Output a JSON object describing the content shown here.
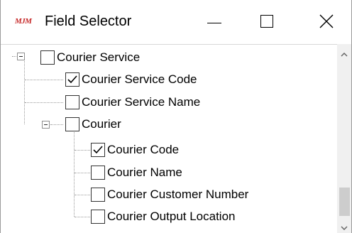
{
  "window": {
    "logo_text": "MJM",
    "title": "Field Selector"
  },
  "tree": {
    "nodes": [
      {
        "label": "Courier Service",
        "checked": false,
        "expandable": true,
        "expanded": true
      },
      {
        "label": "Courier Service Code",
        "checked": true,
        "expandable": false
      },
      {
        "label": "Courier Service Name",
        "checked": false,
        "expandable": false
      },
      {
        "label": "Courier",
        "checked": false,
        "expandable": true,
        "expanded": true
      },
      {
        "label": "Courier Code",
        "checked": true,
        "expandable": false
      },
      {
        "label": "Courier Name",
        "checked": false,
        "expandable": false
      },
      {
        "label": "Courier Customer Number",
        "checked": false,
        "expandable": false
      },
      {
        "label": "Courier Output Location",
        "checked": false,
        "expandable": false
      }
    ]
  },
  "icons": {
    "minimize": "minimize-icon",
    "maximize": "maximize-icon",
    "close": "close-icon",
    "expander": "collapse-minus-icon",
    "check": "checkmark-icon",
    "scroll_up": "chevron-up-icon",
    "scroll_down": "chevron-down-icon"
  },
  "colors": {
    "logo": "#c62828",
    "checkbox_border": "#333333",
    "tree_lines": "#9a9a9a",
    "scrollbar_track": "#f0f0f0",
    "scrollbar_thumb": "#cdcdcd"
  }
}
